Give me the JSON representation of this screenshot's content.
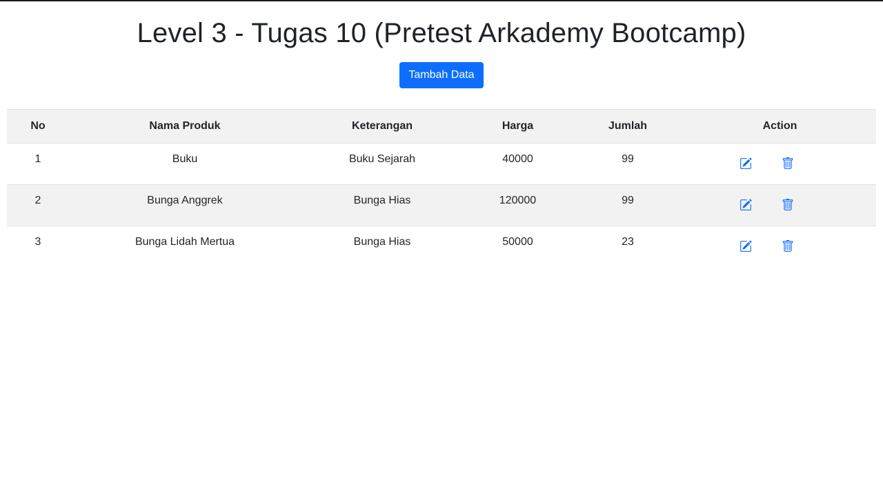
{
  "page": {
    "title": "Level 3 - Tugas 10 (Pretest Arkademy Bootcamp)",
    "add_button_label": "Tambah Data"
  },
  "table": {
    "headers": [
      "No",
      "Nama Produk",
      "Keterangan",
      "Harga",
      "Jumlah",
      "Action"
    ],
    "rows": [
      {
        "no": "1",
        "nama": "Buku",
        "keterangan": "Buku Sejarah",
        "harga": "40000",
        "jumlah": "99"
      },
      {
        "no": "2",
        "nama": "Bunga Anggrek",
        "keterangan": "Bunga Hias",
        "harga": "120000",
        "jumlah": "99"
      },
      {
        "no": "3",
        "nama": "Bunga Lidah Mertua",
        "keterangan": "Bunga Hias",
        "harga": "50000",
        "jumlah": "23"
      }
    ]
  },
  "colors": {
    "primary": "#0d6efd",
    "striped_row": "#f2f2f2"
  },
  "icons": {
    "edit": "edit-icon",
    "delete": "trash-icon"
  }
}
